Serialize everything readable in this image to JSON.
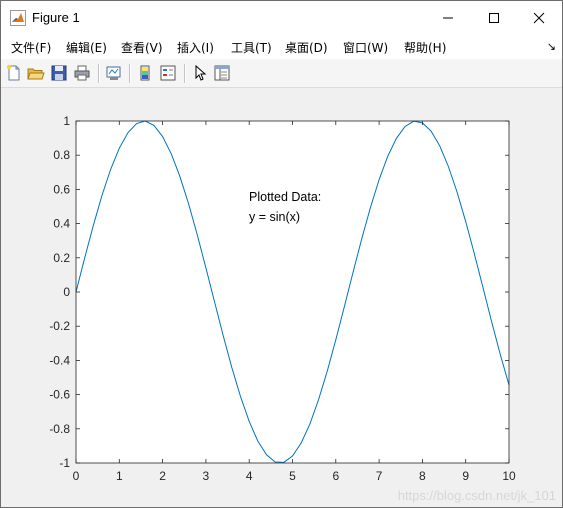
{
  "window": {
    "title": "Figure 1",
    "controls": [
      "minimize",
      "maximize",
      "close"
    ]
  },
  "menu": {
    "items": [
      "文件(F)",
      "编辑(E)",
      "查看(V)",
      "插入(I)",
      "工具(T)",
      "桌面(D)",
      "窗口(W)",
      "帮助(H)"
    ],
    "overflow_arrow": "↘"
  },
  "toolbar": {
    "buttons": [
      "new-figure-icon",
      "open-file-icon",
      "save-icon",
      "print-icon",
      "link-plot-icon",
      "insert-colorbar-icon",
      "insert-legend-icon",
      "edit-plot-arrow-icon",
      "property-inspector-icon"
    ]
  },
  "annotation": {
    "line1": "Plotted Data:",
    "line2": "y = sin(x)"
  },
  "watermark": "https://blog.csdn.net/jk_101",
  "chart_data": {
    "type": "line",
    "title": "",
    "xlabel": "",
    "ylabel": "",
    "xlim": [
      0,
      10
    ],
    "ylim": [
      -1,
      1
    ],
    "xticks": [
      0,
      1,
      2,
      3,
      4,
      5,
      6,
      7,
      8,
      9,
      10
    ],
    "yticks": [
      -1,
      -0.8,
      -0.6,
      -0.4,
      -0.2,
      0,
      0.2,
      0.4,
      0.6,
      0.8,
      1
    ],
    "xtick_labels": [
      "0",
      "1",
      "2",
      "3",
      "4",
      "5",
      "6",
      "7",
      "8",
      "9",
      "10"
    ],
    "ytick_labels": [
      "-1",
      "-0.8",
      "-0.6",
      "-0.4",
      "-0.2",
      "0",
      "0.2",
      "0.4",
      "0.6",
      "0.8",
      "1"
    ],
    "grid": false,
    "series": [
      {
        "color": "#0072bd",
        "x": [
          0,
          0.2,
          0.4,
          0.6,
          0.8,
          1.0,
          1.2,
          1.4,
          1.6,
          1.8,
          2.0,
          2.2,
          2.4,
          2.6,
          2.8,
          3.0,
          3.2,
          3.4,
          3.6,
          3.8,
          4.0,
          4.2,
          4.4,
          4.6,
          4.8,
          5.0,
          5.2,
          5.4,
          5.6,
          5.8,
          6.0,
          6.2,
          6.4,
          6.6,
          6.8,
          7.0,
          7.2,
          7.4,
          7.6,
          7.8,
          8.0,
          8.2,
          8.4,
          8.6,
          8.8,
          9.0,
          9.2,
          9.4,
          9.6,
          9.8,
          10.0
        ],
        "y": [
          0,
          0.199,
          0.389,
          0.565,
          0.717,
          0.841,
          0.932,
          0.985,
          1.0,
          0.974,
          0.909,
          0.808,
          0.675,
          0.516,
          0.335,
          0.141,
          -0.058,
          -0.256,
          -0.443,
          -0.612,
          -0.757,
          -0.872,
          -0.952,
          -0.994,
          -0.996,
          -0.959,
          -0.883,
          -0.773,
          -0.631,
          -0.465,
          -0.279,
          -0.083,
          0.117,
          0.312,
          0.494,
          0.657,
          0.794,
          0.899,
          0.968,
          0.999,
          0.989,
          0.941,
          0.855,
          0.734,
          0.585,
          0.412,
          0.223,
          0.025,
          -0.175,
          -0.367,
          -0.544
        ]
      }
    ]
  }
}
